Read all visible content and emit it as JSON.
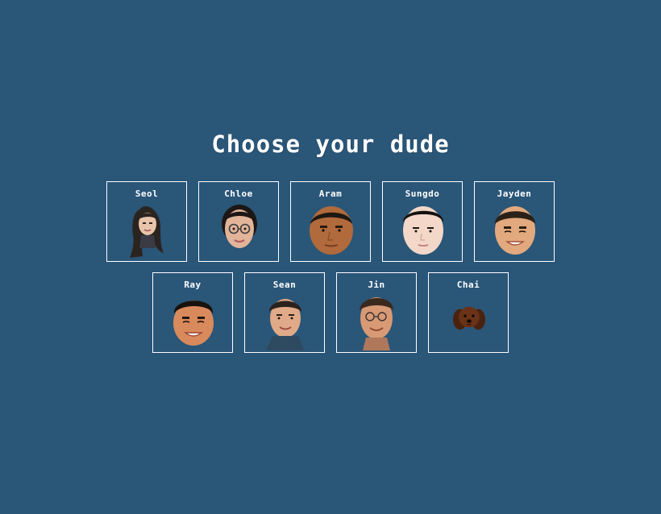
{
  "title": "Choose your dude",
  "characters": [
    {
      "name": "Seol",
      "icon": "face-seol-icon"
    },
    {
      "name": "Chloe",
      "icon": "face-chloe-icon"
    },
    {
      "name": "Aram",
      "icon": "face-aram-icon"
    },
    {
      "name": "Sungdo",
      "icon": "face-sungdo-icon"
    },
    {
      "name": "Jayden",
      "icon": "face-jayden-icon"
    },
    {
      "name": "Ray",
      "icon": "face-ray-icon"
    },
    {
      "name": "Sean",
      "icon": "face-sean-icon"
    },
    {
      "name": "Jin",
      "icon": "face-jin-icon"
    },
    {
      "name": "Chai",
      "icon": "dog-face-chai-icon"
    }
  ],
  "colors": {
    "background": "#2a5678",
    "border": "#ffffff",
    "text": "#ffffff"
  }
}
